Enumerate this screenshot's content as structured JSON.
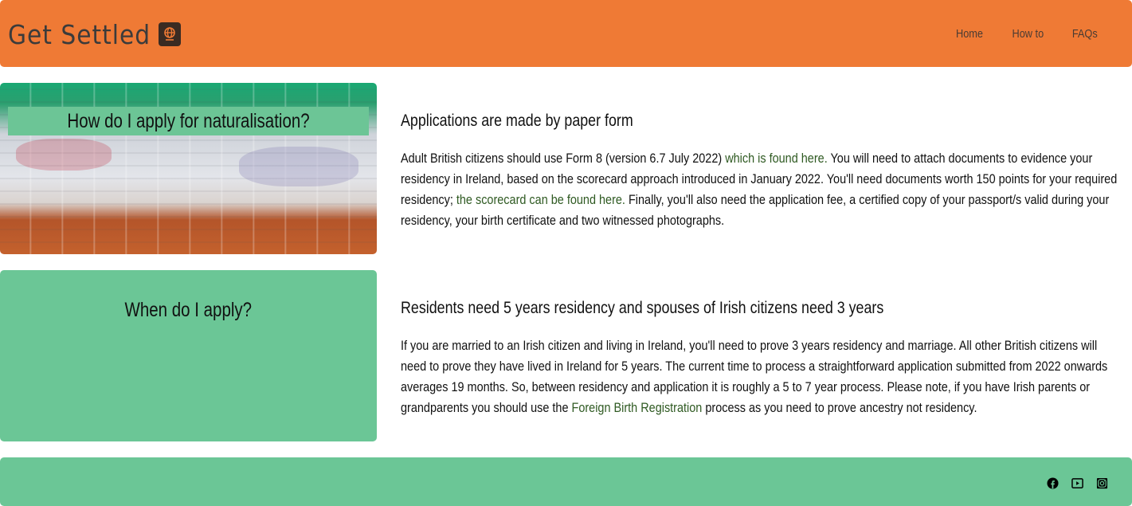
{
  "header": {
    "brand": "Get Settled",
    "brand_icon": "passport-icon",
    "nav": [
      "Home",
      "How to",
      "FAQs"
    ]
  },
  "cards": [
    {
      "title": "How do I apply for naturalisation?"
    },
    {
      "title": "When do I apply?"
    }
  ],
  "sections": [
    {
      "heading": "Applications are made by paper form",
      "p1": "Adult British citizens should use Form 8 (version 6.7 July 2022) ",
      "link1": "which is found here.",
      "p2": " You will need to attach documents to evidence your residency in Ireland, based on the scorecard approach introduced in January 2022. You'll need documents worth 150 points for your required residency; ",
      "link2": "the scorecard can be found here.",
      "p3": " Finally, you'll also need the application fee, a certified copy of your passport/s valid during your residency, your birth certificate and two witnessed photographs."
    },
    {
      "heading": "Residents need 5 years residency and spouses of Irish citizens need 3 years",
      "p1": "If you are married to an Irish citizen and living in Ireland, you'll need to prove 3 years residency and marriage. All other British citizens will need to prove they have lived in Ireland for 5 years. The current time to process a straightforward application submitted from 2022 onwards averages 19 months. So, between residency and application it is roughly a 5 to 7 year process. Please note, if you have Irish parents or grandparents you should use the ",
      "link1": "Foreign Birth Registration",
      "p2": " process as you need to prove ancestry not residency."
    }
  ],
  "footer": {
    "social_icons": [
      "facebook-icon",
      "youtube-icon",
      "instagram-icon"
    ]
  },
  "colors": {
    "header_bg": "#ef7a35",
    "card_green": "#6bc696",
    "link": "#2f5a22"
  }
}
